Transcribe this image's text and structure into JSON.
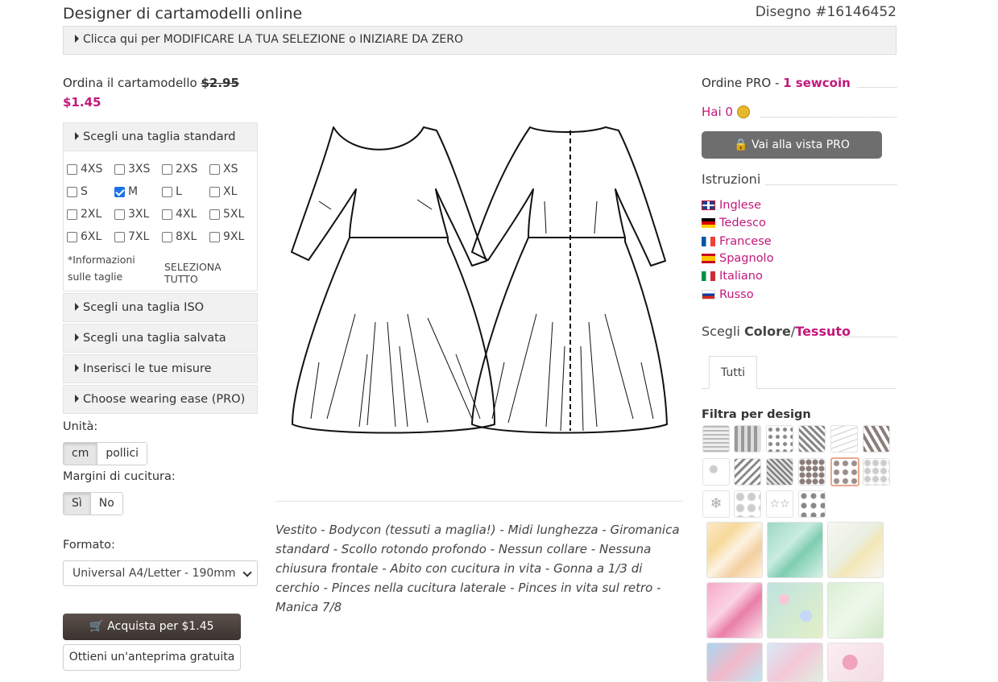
{
  "header": {
    "title": "Designer di cartamodelli online",
    "design_id": "Disegno #16146452",
    "modify_bar": "Clicca qui per MODIFICARE LA TUA SELEZIONE o INIZIARE DA ZERO"
  },
  "order": {
    "label": "Ordina il cartamodello",
    "old_price": "$2.95",
    "new_price": "$1.45"
  },
  "sizes": {
    "standard_header": "Scegli una taglia standard",
    "rows": [
      [
        {
          "label": "4XS",
          "checked": false
        },
        {
          "label": "3XS",
          "checked": false
        },
        {
          "label": "2XS",
          "checked": false
        },
        {
          "label": "XS",
          "checked": false
        }
      ],
      [
        {
          "label": "S",
          "checked": false
        },
        {
          "label": "M",
          "checked": true
        },
        {
          "label": "L",
          "checked": false
        },
        {
          "label": "XL",
          "checked": false
        }
      ],
      [
        {
          "label": "2XL",
          "checked": false
        },
        {
          "label": "3XL",
          "checked": false
        },
        {
          "label": "4XL",
          "checked": false
        },
        {
          "label": "5XL",
          "checked": false
        }
      ],
      [
        {
          "label": "6XL",
          "checked": false
        },
        {
          "label": "7XL",
          "checked": false
        },
        {
          "label": "8XL",
          "checked": false
        },
        {
          "label": "9XL",
          "checked": false
        }
      ]
    ],
    "info_link": "*Informazioni sulle taglie",
    "select_all": "SELEZIONA TUTTO",
    "iso_header": "Scegli una taglia ISO",
    "saved_header": "Scegli una taglia salvata",
    "measures_header": "Inserisci le tue misure",
    "ease_header": "Choose wearing ease (PRO)"
  },
  "units": {
    "label": "Unità:",
    "options": [
      "cm",
      "pollici"
    ],
    "selected": "cm"
  },
  "seam": {
    "label": "Margini di cucitura:",
    "options": [
      "Sì",
      "No"
    ],
    "selected": "Sì"
  },
  "format": {
    "label": "Formato:",
    "value": "Universal A4/Letter - 190mm"
  },
  "buttons": {
    "buy": "Acquista per $1.45",
    "preview": "Ottieni un'anteprima gratuita"
  },
  "description": "Vestito - Bodycon (tessuti a maglia!) - Midi lunghezza - Giromanica standard - Scollo rotondo profondo - Nessun collare - Nessuna chiusura frontale - Abito con cucitura in vita - Gonna a 1/3 di cerchio - Pinces nella cucitura laterale - Pinces in vita sul retro - Manica 7/8",
  "pro": {
    "label": "Ordine PRO - ",
    "cost": "1 sewcoin",
    "balance": "Hai 0",
    "button": "Vai alla vista PRO"
  },
  "instructions": {
    "title": "Istruzioni",
    "languages": [
      {
        "label": "Inglese",
        "flag": "uk-flag-icon"
      },
      {
        "label": "Tedesco",
        "flag": "germany-flag-icon"
      },
      {
        "label": "Francese",
        "flag": "france-flag-icon"
      },
      {
        "label": "Spagnolo",
        "flag": "spain-flag-icon"
      },
      {
        "label": "Italiano",
        "flag": "italy-flag-icon"
      },
      {
        "label": "Russo",
        "flag": "russia-flag-icon"
      }
    ]
  },
  "fabric": {
    "title_prefix": "Scegli ",
    "color_word": "Colore",
    "separator": "/",
    "fabric_word": "Tessuto",
    "tab": "Tutti",
    "filter_title": "Filtra per design"
  },
  "colors": {
    "accent": "#c2187c",
    "buy_button": "#443b37",
    "pro_button": "#6e6e6e"
  }
}
